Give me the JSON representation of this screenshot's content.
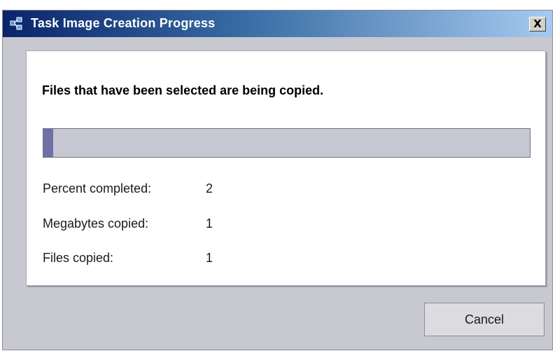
{
  "window": {
    "title": "Task Image Creation Progress",
    "close_label": "X"
  },
  "panel": {
    "heading": "Files that have been selected are being copied.",
    "progress_percent": 2,
    "stats": [
      {
        "label": "Percent completed:",
        "value": "2"
      },
      {
        "label": "Megabytes copied:",
        "value": "1"
      },
      {
        "label": "Files copied:",
        "value": "1"
      }
    ]
  },
  "buttons": {
    "cancel_label": "Cancel"
  },
  "colors": {
    "titlebar_start": "#0a246a",
    "titlebar_end": "#a6caf0",
    "progress_fill": "#7070a8",
    "progress_track": "#c8c8d4",
    "dialog_bg": "#c8c8d0"
  },
  "icons": {
    "app_icon": "app-network-icon",
    "close_icon": "close-icon"
  }
}
